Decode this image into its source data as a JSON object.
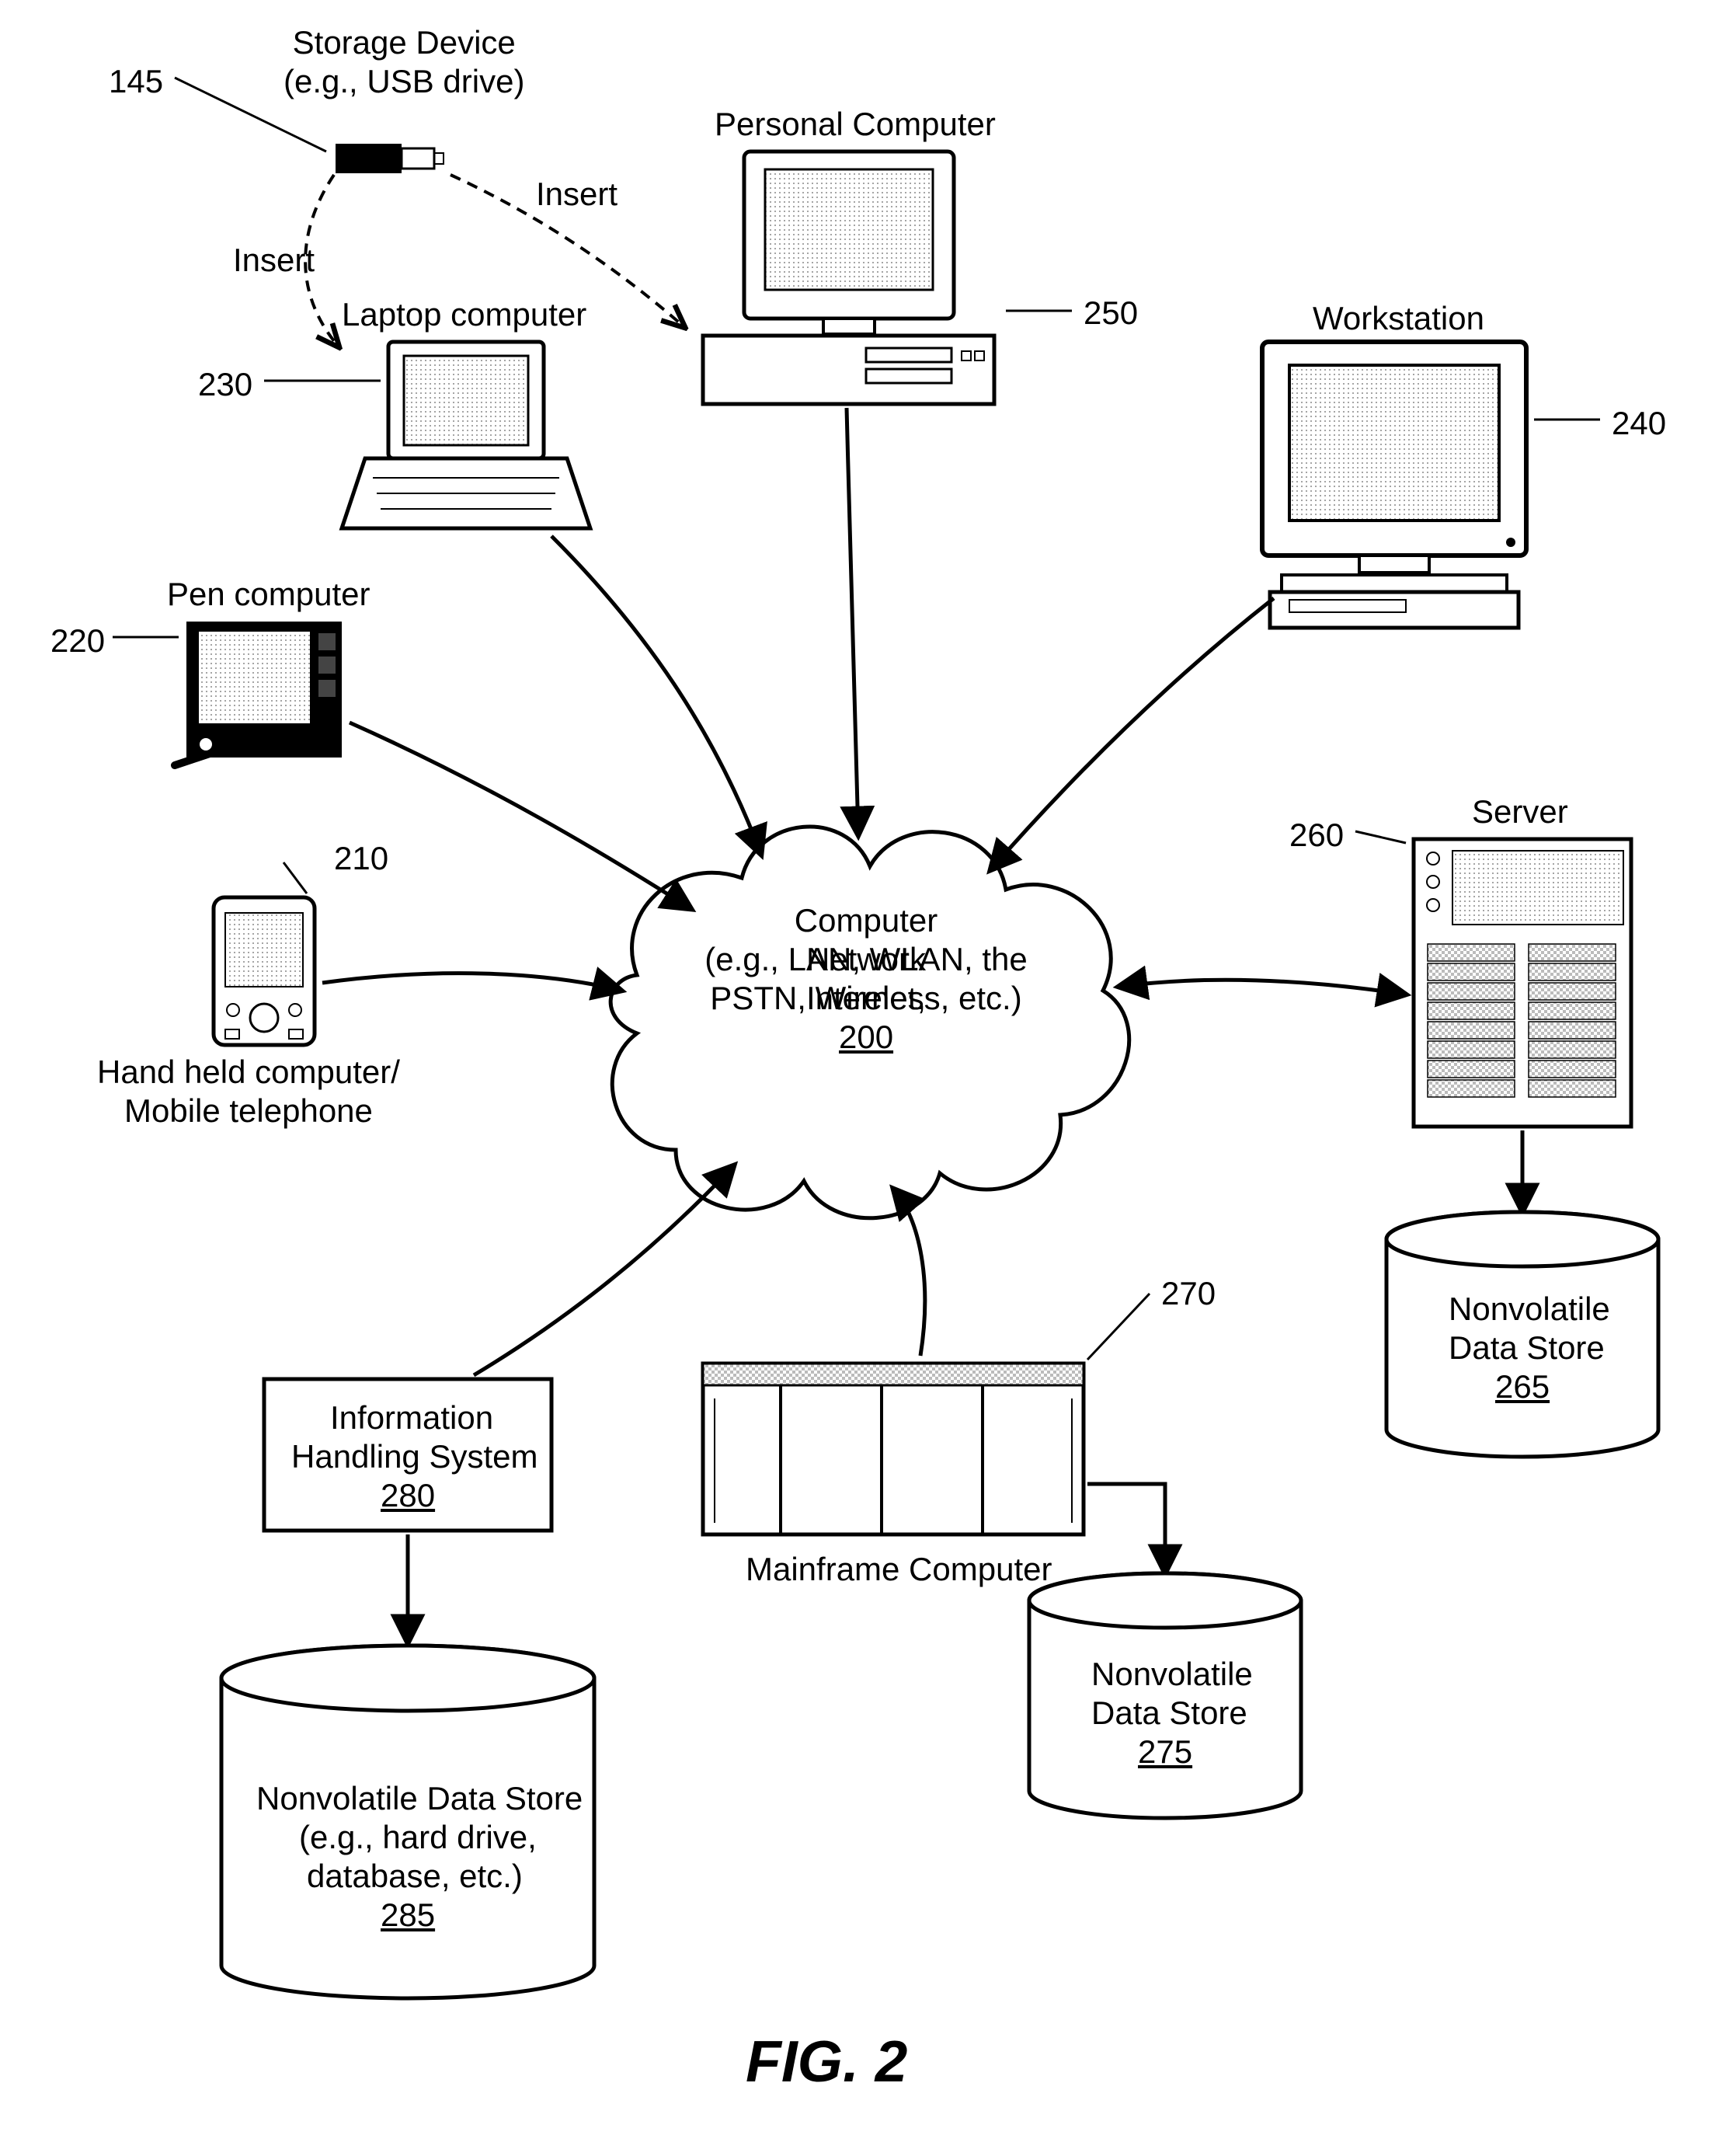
{
  "labels": {
    "storage_device": "Storage Device\n(e.g., USB drive)",
    "ref145": "145",
    "insert_left": "Insert",
    "insert_right": "Insert",
    "laptop": "Laptop computer",
    "ref230": "230",
    "personal_computer": "Personal Computer",
    "ref250": "250",
    "workstation": "Workstation",
    "ref240": "240",
    "pen_computer": "Pen computer",
    "ref220": "220",
    "handheld": "Hand held computer/\nMobile telephone",
    "ref210": "210",
    "cloud_line1": "Computer Network",
    "cloud_line2": "(e.g., LAN, WLAN, the Internet,",
    "cloud_line3": "PSTN, Wireless, etc.)",
    "cloud_ref": "200",
    "server": "Server",
    "ref260": "260",
    "nvds265_line1": "Nonvolatile",
    "nvds265_line2": "Data Store",
    "nvds265_ref": "265",
    "ihs_line1": "Information",
    "ihs_line2": "Handling System",
    "ihs_ref": "280",
    "ref270": "270",
    "mainframe": "Mainframe Computer",
    "nvds275_line1": "Nonvolatile",
    "nvds275_line2": "Data Store",
    "nvds275_ref": "275",
    "nvds285_line1": "Nonvolatile Data Store",
    "nvds285_line2": "(e.g., hard drive,",
    "nvds285_line3": "database, etc.)",
    "nvds285_ref": "285",
    "figure": "FIG. 2"
  }
}
